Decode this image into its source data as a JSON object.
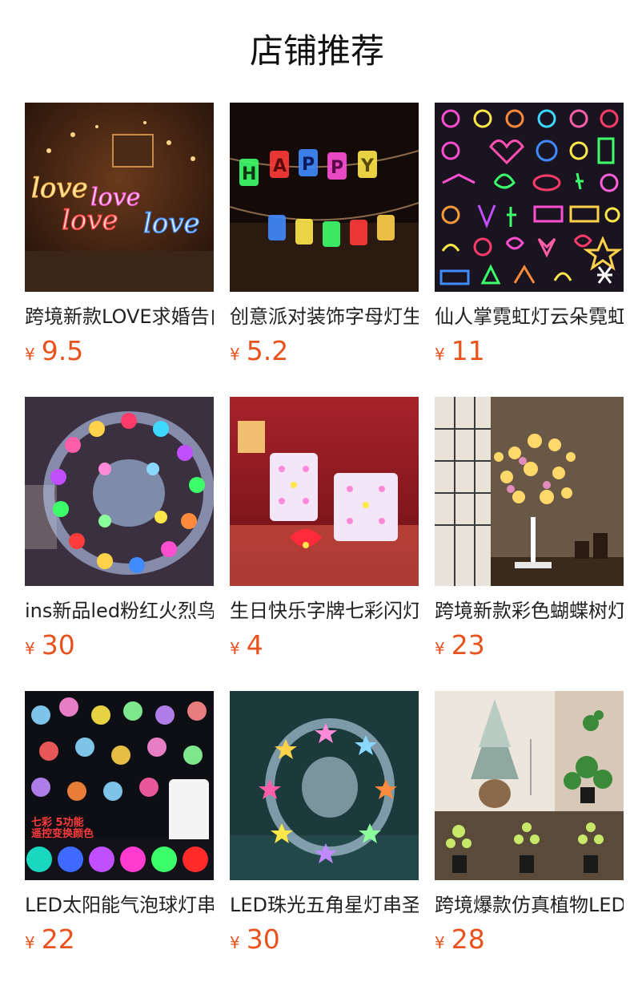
{
  "header": {
    "title": "店铺推荐"
  },
  "currency": "¥",
  "colors": {
    "price": "#e8531d",
    "title": "#111111"
  },
  "products": [
    {
      "name": "跨境新款LOVE求婚告白霓虹灯",
      "price": "9.5",
      "image": "neon-love-signs-image"
    },
    {
      "name": "创意派对装饰字母灯生日快乐",
      "price": "5.2",
      "image": "happy-birthday-letter-lights-image"
    },
    {
      "name": "仙人掌霓虹灯云朵霓虹灯小夜灯",
      "price": "11",
      "image": "neon-shapes-collection-image"
    },
    {
      "name": "ins新品led粉红火烈鸟灯串",
      "price": "30",
      "image": "colorful-string-light-reel-image"
    },
    {
      "name": "生日快乐字牌七彩闪灯装饰",
      "price": "4",
      "image": "happy-marquee-letters-image"
    },
    {
      "name": "跨境新款彩色蝴蝶树灯装饰",
      "price": "23",
      "image": "butterfly-tree-lamp-image"
    },
    {
      "name": "LED太阳能气泡球灯串遥控",
      "price": "22",
      "image": "bubble-ball-lights-remote-image"
    },
    {
      "name": "LED珠光五角星灯串圣诞",
      "price": "30",
      "image": "star-string-light-reel-image"
    },
    {
      "name": "跨境爆款仿真植物LED灯",
      "price": "28",
      "image": "artificial-plant-lamps-image"
    }
  ]
}
